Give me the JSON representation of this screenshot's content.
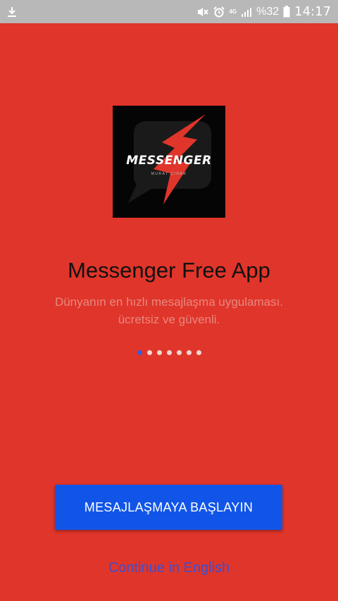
{
  "status_bar": {
    "network": "4G",
    "battery_percent": "%32",
    "time": "14:17",
    "icons": [
      "download-icon",
      "mute-icon",
      "alarm-icon",
      "signal-icon",
      "battery-icon"
    ]
  },
  "logo": {
    "wordmark": "MESSENGER",
    "author": "MURAT ÇINAR",
    "colors": {
      "background": "#050505",
      "bubble": "#1a1a1a",
      "bolt": "#e0352a"
    }
  },
  "onboarding": {
    "title": "Messenger Free App",
    "subtitle_line1": "Dünyanın en hızlı mesajlaşma uygulaması.",
    "subtitle_line2": "ücretsiz ve güvenli.",
    "page_count": 7,
    "active_page": 1
  },
  "actions": {
    "start_label": "MESAJLAŞMAYA BAŞLAYIN",
    "english_label": "Continue in English"
  },
  "colors": {
    "background": "#e0352a",
    "status_bar": "#b8b8b8",
    "primary_button": "#1155e8",
    "link": "#3d4fd0",
    "active_dot": "#3b5bdb"
  }
}
